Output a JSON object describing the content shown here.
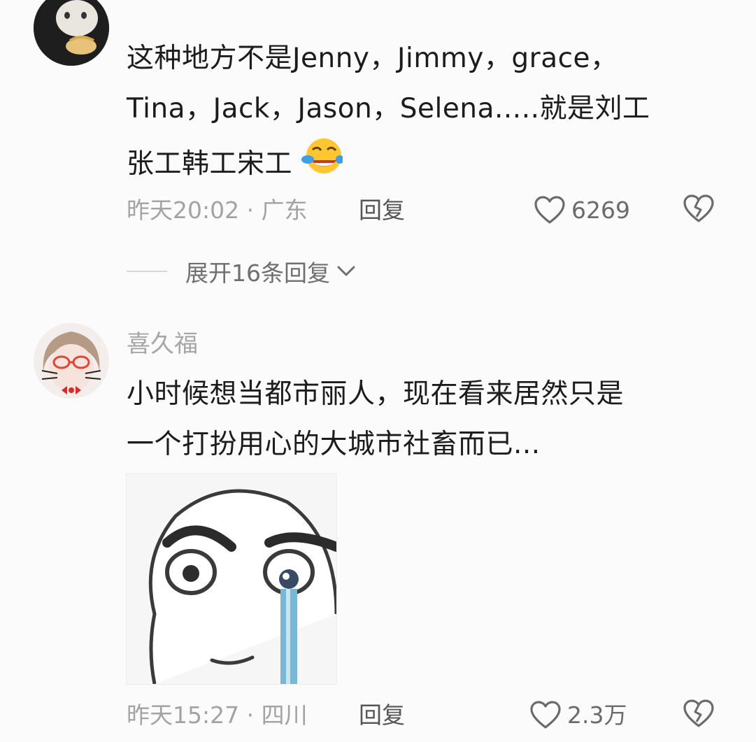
{
  "comments": [
    {
      "username": "",
      "text_lines": [
        "这种地方不是Jenny，Jimmy，grace，",
        "Tina，Jack，Jason，Selena.....就是刘工",
        "张工韩工宋工"
      ],
      "emoji": "laughing-crying-emoji",
      "time_location": "昨天20:02 · 广东",
      "reply_label": "回复",
      "likes": "6269",
      "expand_label": "展开16条回复"
    },
    {
      "username": "喜久福",
      "text_lines": [
        "小时候想当都市丽人，现在看来居然只是",
        "一个打扮用心的大城市社畜而已..."
      ],
      "sticker": "crying-face-sticker",
      "time_location": "昨天15:27 · 四川",
      "reply_label": "回复",
      "likes": "2.3万"
    }
  ],
  "icons": {
    "like": "heart-outline-icon",
    "dislike": "broken-heart-icon",
    "expand": "chevron-down-icon"
  },
  "colors": {
    "background": "#fbfbfb",
    "text": "#1c1c1c",
    "muted": "#a3a3a3"
  }
}
